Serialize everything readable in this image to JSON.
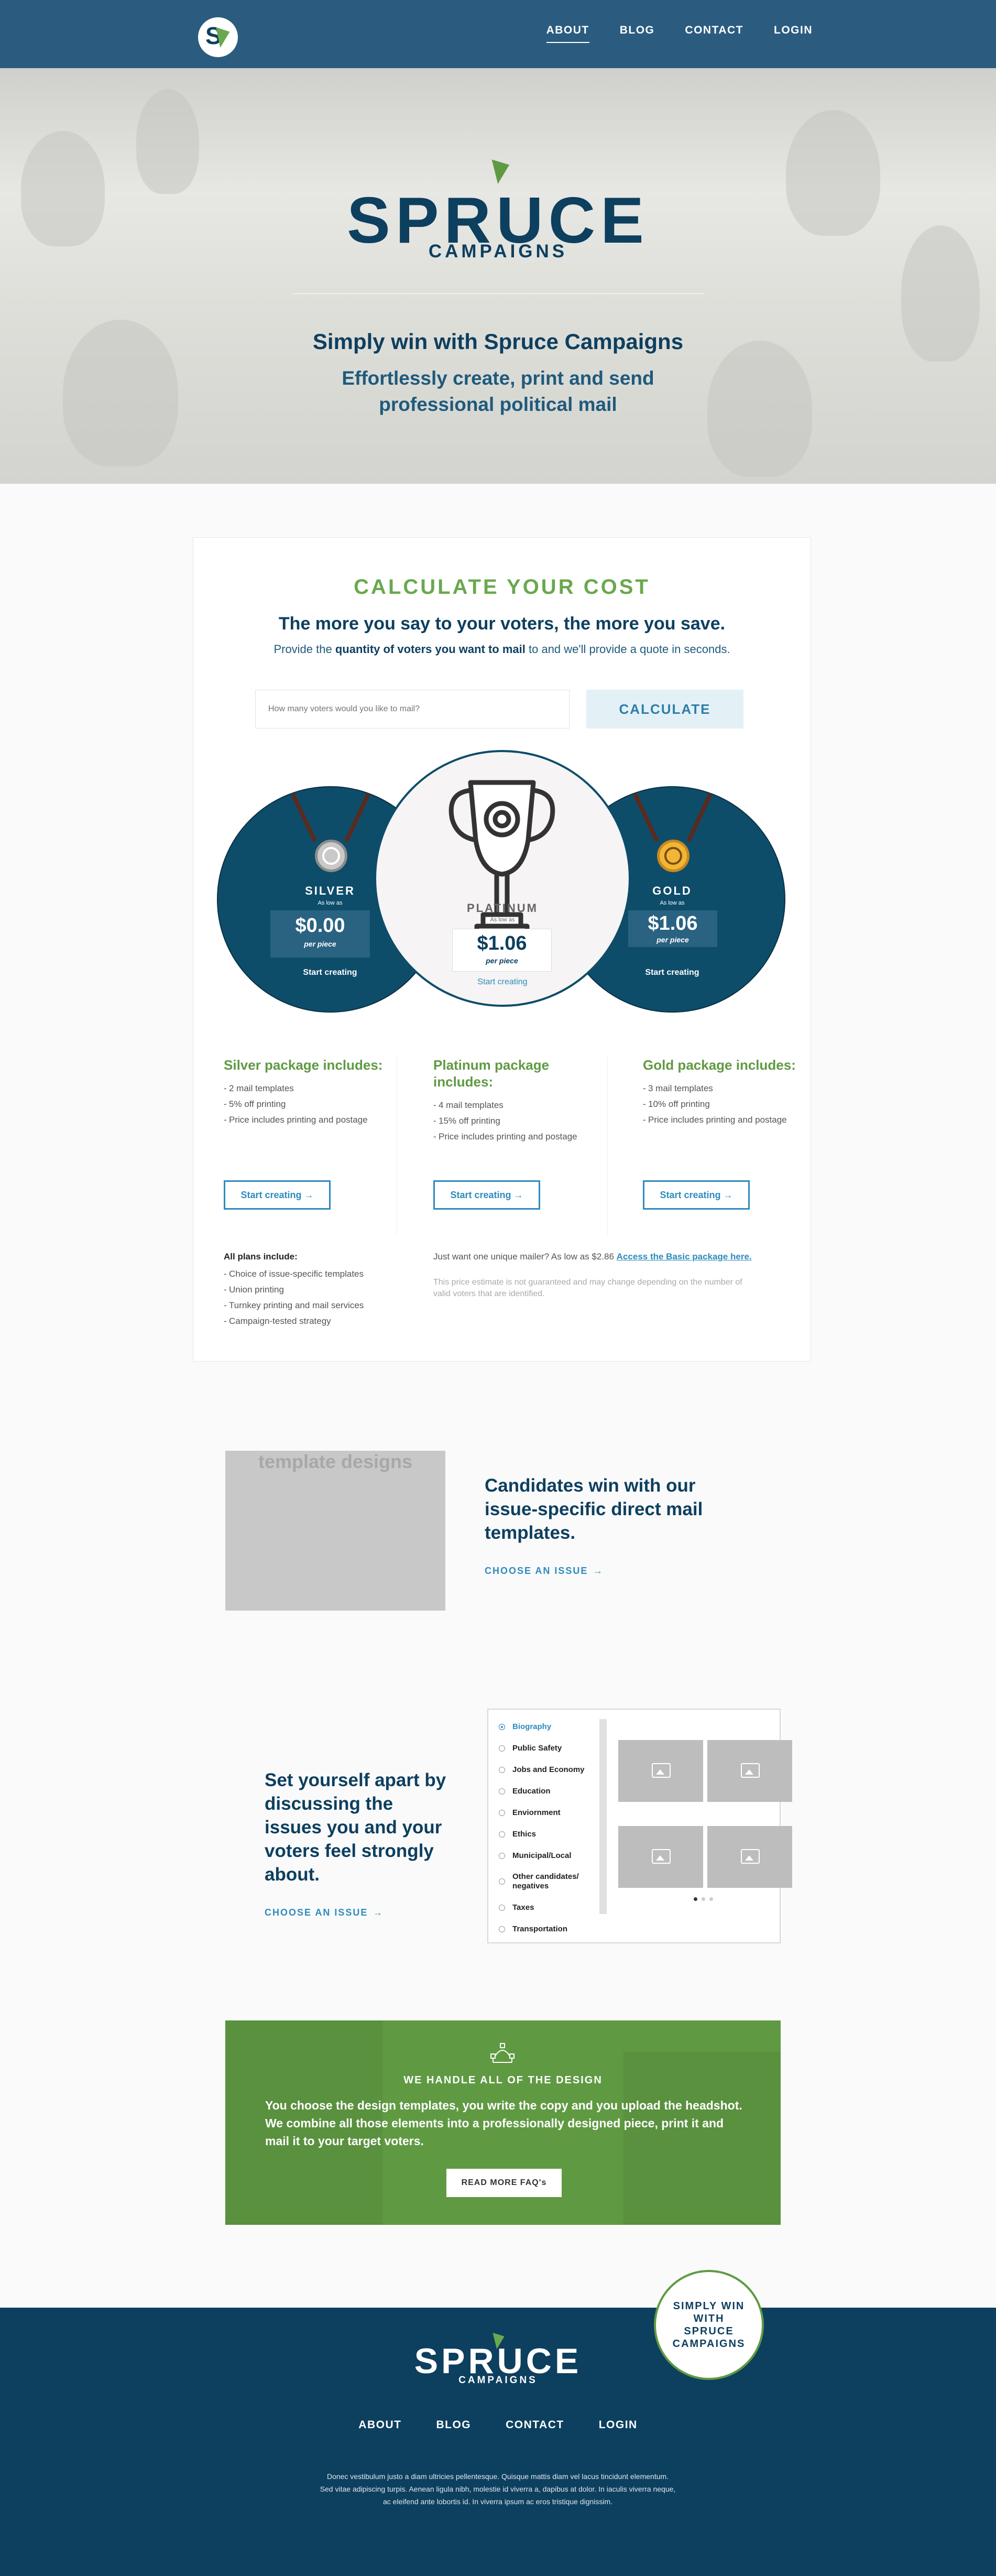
{
  "nav": {
    "logo_letter": "S",
    "links": [
      "ABOUT",
      "BLOG",
      "CONTACT",
      "LOGIN"
    ]
  },
  "hero": {
    "brand": "SPRUCE",
    "sub": "CAMPAIGNS",
    "tagline": "Simply win with Spruce Campaigns",
    "tagline2": "Effortlessly create, print and send professional political mail"
  },
  "calculator": {
    "title": "CALCULATE YOUR COST",
    "heading": "The more you say to your voters, the more you save.",
    "desc_pre": "Provide the ",
    "desc_bold": "quantity of voters you want to mail",
    "desc_post": " to and we'll provide a quote in seconds.",
    "input_placeholder": "How many voters would you like to mail?",
    "button": "CALCULATE"
  },
  "packages": [
    {
      "level": "SILVER",
      "as_low_as": "As low as",
      "price": "$0.00",
      "per_piece": "per piece",
      "cta": "Start creating",
      "col_title": "Silver package includes:",
      "items": [
        "2 mail templates",
        "5% off printing",
        "Price includes printing and postage"
      ],
      "button": "Start creating →"
    },
    {
      "level": "PLATINUM",
      "as_low_as": "As low as",
      "price": "$1.06",
      "per_piece": "per piece",
      "cta": "Start creating",
      "col_title": "Platinum package includes:",
      "items": [
        "4 mail templates",
        "15% off printing",
        "Price includes printing and postage"
      ],
      "button": "Start creating →"
    },
    {
      "level": "GOLD",
      "as_low_as": "As low as",
      "price": "$1.06",
      "per_piece": "per piece",
      "cta": "Start creating",
      "col_title": "Gold package includes:",
      "items": [
        "3 mail templates",
        "10% off printing",
        "Price includes printing and postage"
      ],
      "button": "Start creating →"
    }
  ],
  "plans": {
    "title": "All plans include:",
    "items": [
      "Choice of issue-specific templates",
      "Union printing",
      "Turnkey printing and mail services",
      "Campaign-tested strategy"
    ],
    "unique_text": "Just want one unique mailer? As low as $2.86",
    "unique_link": "Access the Basic package here.",
    "disclaimer": "This price estimate is not guaranteed and may change depending on the number of valid voters that are identified."
  },
  "candidates": {
    "placeholder": "template designs",
    "heading": "Candidates win with our issue-specific direct mail templates.",
    "link": "CHOOSE AN ISSUE"
  },
  "issues": {
    "heading": "Set yourself apart by discussing the issues you and your voters feel strongly about.",
    "link": "CHOOSE AN ISSUE",
    "list": [
      "Biography",
      "Public Safety",
      "Jobs and Economy",
      "Education",
      "Enviornment",
      "Ethics",
      "Municipal/Local",
      "Other candidates/ negatives",
      "Taxes",
      "Transportation"
    ]
  },
  "design": {
    "title": "WE HANDLE ALL OF THE DESIGN",
    "text": "You choose the design templates, you write the copy and you upload the headshot. We combine all those elements into a professionally designed piece, print it and mail it to your target voters.",
    "button": "READ MORE FAQ's"
  },
  "footer": {
    "brand": "SPRUCE",
    "sub": "CAMPAIGNS",
    "links": [
      "ABOUT",
      "BLOG",
      "CONTACT",
      "LOGIN"
    ],
    "text": "Donec vestibulum justo a diam ultricies pellentesque. Quisque mattis diam vel lacus tincidunt elementum. Sed vitae adipiscing turpis. Aenean ligula nibh, molestie id viverra a, dapibus at dolor. In iaculis viverra neque, ac eleifend ante lobortis id. In viverra ipsum ac eros tristique dignissim.",
    "badge": "SIMPLY WIN WITH SPRUCE CAMPAIGNS"
  },
  "colors": {
    "navy": "#0d3f5f",
    "green": "#6aa84f",
    "blue": "#2e8bbd"
  }
}
